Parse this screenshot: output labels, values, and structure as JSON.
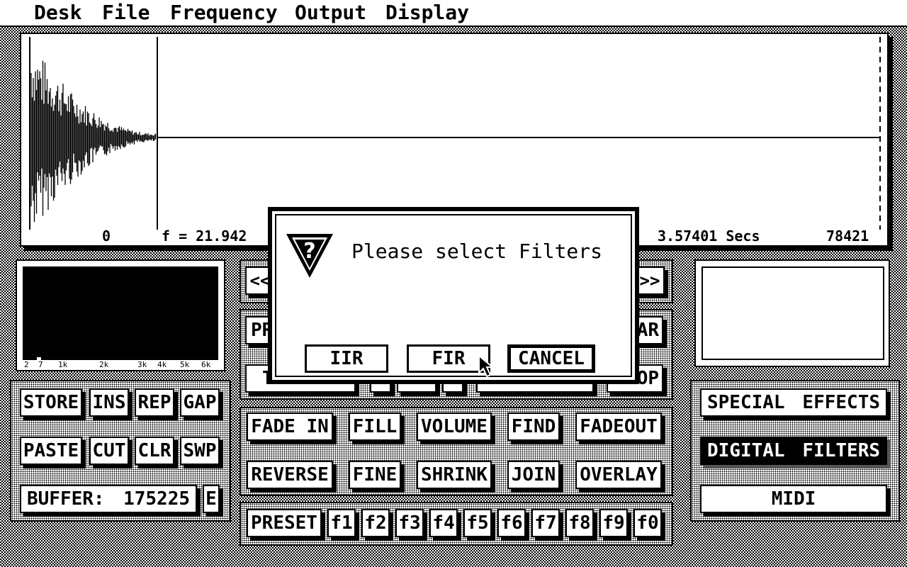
{
  "menu": {
    "items": [
      "Desk",
      "File",
      "Frequency",
      "Output",
      "Display"
    ]
  },
  "waveform": {
    "start_label": "0",
    "freq_label": "f = 21.942",
    "duration_label": "3.57401 Secs",
    "end_label": "78421"
  },
  "spectrum": {
    "ticks": [
      "2",
      "7",
      "1k",
      "2k",
      "3k",
      "4k",
      "5k",
      "6k"
    ]
  },
  "transport": {
    "left_label": "<<",
    "right_label": ">>",
    "partial_left_1": "PR",
    "partial_right_1": "AR",
    "partial_left_2": "T",
    "partial_right_2": "OP"
  },
  "buffer_panel": {
    "store": "STORE",
    "ins": "INS",
    "rep": "REP",
    "gap": "GAP",
    "paste": "PASTE",
    "cut": "CUT",
    "clr": "CLR",
    "swp": "SWP",
    "buffer_label": "BUFFER:",
    "buffer_value": "175225",
    "e": "E"
  },
  "edit_panel": {
    "fade_in": "FADE IN",
    "fill": "FILL",
    "volume": "VOLUME",
    "find": "FIND",
    "fadeout": "FADEOUT",
    "reverse": "REVERSE",
    "fine": "FINE",
    "shrink": "SHRINK",
    "join": "JOIN",
    "overlay": "OVERLAY"
  },
  "preset_bar": {
    "preset": "PRESET",
    "keys": [
      "f1",
      "f2",
      "f3",
      "f4",
      "f5",
      "f6",
      "f7",
      "f8",
      "f9",
      "f0"
    ]
  },
  "effects_panel": {
    "special_effects": [
      "SPECIAL",
      "EFFECTS"
    ],
    "digital_filters": [
      "DIGITAL",
      "FILTERS"
    ],
    "midi": "MIDI"
  },
  "dialog": {
    "message": "Please select Filters",
    "buttons": {
      "iir": "IIR",
      "fir": "FIR",
      "cancel": "CANCEL"
    }
  },
  "colors": {
    "foreground": "#000000",
    "background": "#ffffff"
  }
}
